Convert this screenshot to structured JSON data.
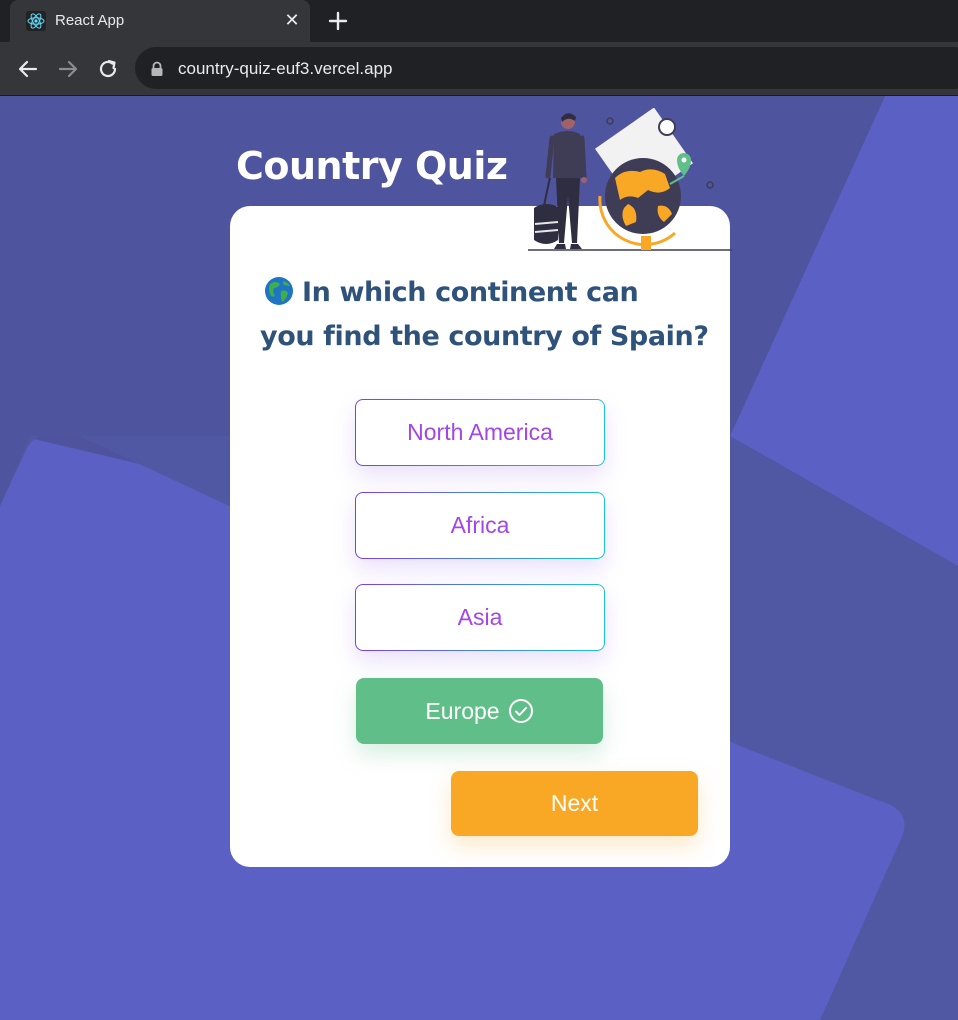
{
  "browser": {
    "tab_title": "React App",
    "url": "country-quiz-euf3.vercel.app",
    "icons": [
      "react-logo-icon",
      "close-icon",
      "plus-icon",
      "back-arrow-icon",
      "forward-arrow-icon",
      "reload-icon",
      "lock-icon"
    ]
  },
  "quiz": {
    "title": "Country Quiz",
    "question_line1": "In which continent can",
    "question_line2": "you find the country of Spain?",
    "question_icon": "globe-emoji-icon",
    "options": [
      {
        "label": "North America",
        "state": "default"
      },
      {
        "label": "Africa",
        "state": "default"
      },
      {
        "label": "Asia",
        "state": "default"
      },
      {
        "label": "Europe",
        "state": "correct"
      }
    ],
    "next_label": "Next"
  },
  "colors": {
    "background": "#5b61c4",
    "title_text": "#ffffff",
    "question_text": "#2f527b",
    "option_text": "#a445e8",
    "correct": "#60bf88",
    "next_button": "#f9a826"
  }
}
